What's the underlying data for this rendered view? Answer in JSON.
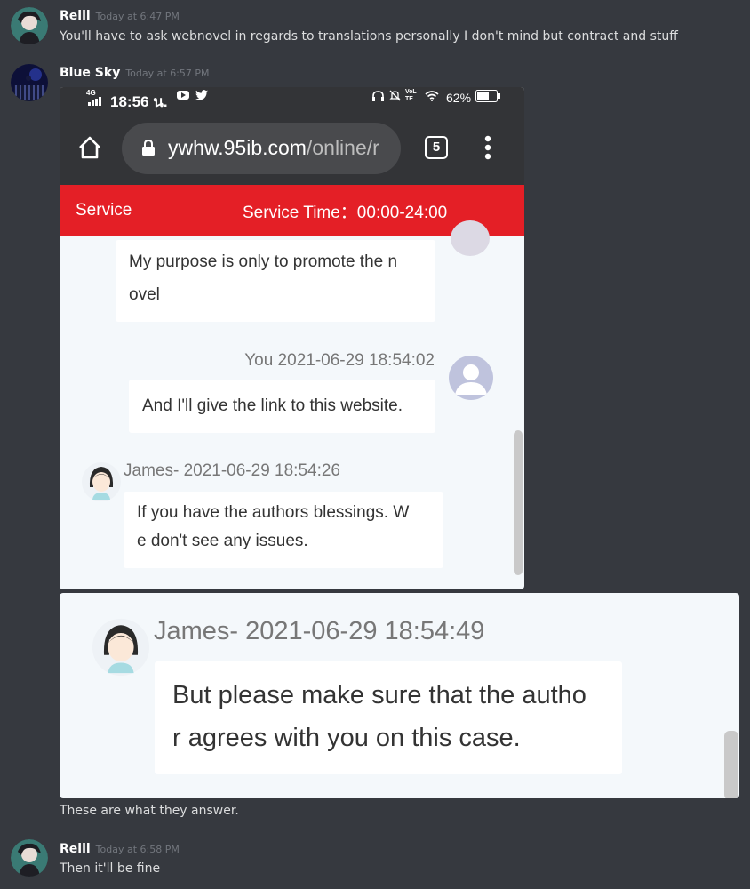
{
  "messages": [
    {
      "username": "Reili",
      "timestamp": "Today at 6:47 PM",
      "text": "You'll have to ask webnovel in regards to translations personally I don't mind but contract and stuff"
    },
    {
      "username": "Blue Sky",
      "timestamp": "Today at 6:57 PM",
      "caption": "These are what they answer."
    },
    {
      "username": "Reili",
      "timestamp": "Today at 6:58 PM",
      "text": "Then it'll be fine"
    }
  ],
  "phone": {
    "status_time": "18:56 น.",
    "network": "4G",
    "volte": "VoLTE",
    "battery": "62%",
    "url_host": "ywhw.95ib.com",
    "url_path": "/online/r",
    "tab_count": "5",
    "service_label": "Service",
    "service_time": "Service Time：00:00-24:00",
    "chat": [
      {
        "lines": [
          "My purpose is only to promote the n",
          "ovel"
        ]
      },
      {
        "meta": "You 2021-06-29 18:54:02",
        "lines": [
          "And I'll give the link to this website."
        ]
      },
      {
        "meta": "James- 2021-06-29 18:54:26",
        "lines": [
          "If you have the authors blessings. W",
          "e don't see any issues."
        ]
      }
    ]
  },
  "zoom": {
    "meta": "James- 2021-06-29 18:54:49",
    "lines": [
      "But please make sure that the autho",
      "r agrees with you on this case."
    ]
  },
  "colors": {
    "background": "#36393f",
    "service_bar": "#e41f26",
    "browser_chrome": "#333437",
    "chat_bg": "#f4f8fb"
  },
  "icons": [
    "home-icon",
    "lock-icon",
    "tabs-icon",
    "more-vert-icon",
    "youtube-icon",
    "twitter-icon",
    "wifi-icon",
    "battery-icon",
    "headphones-icon",
    "mute-icon"
  ]
}
